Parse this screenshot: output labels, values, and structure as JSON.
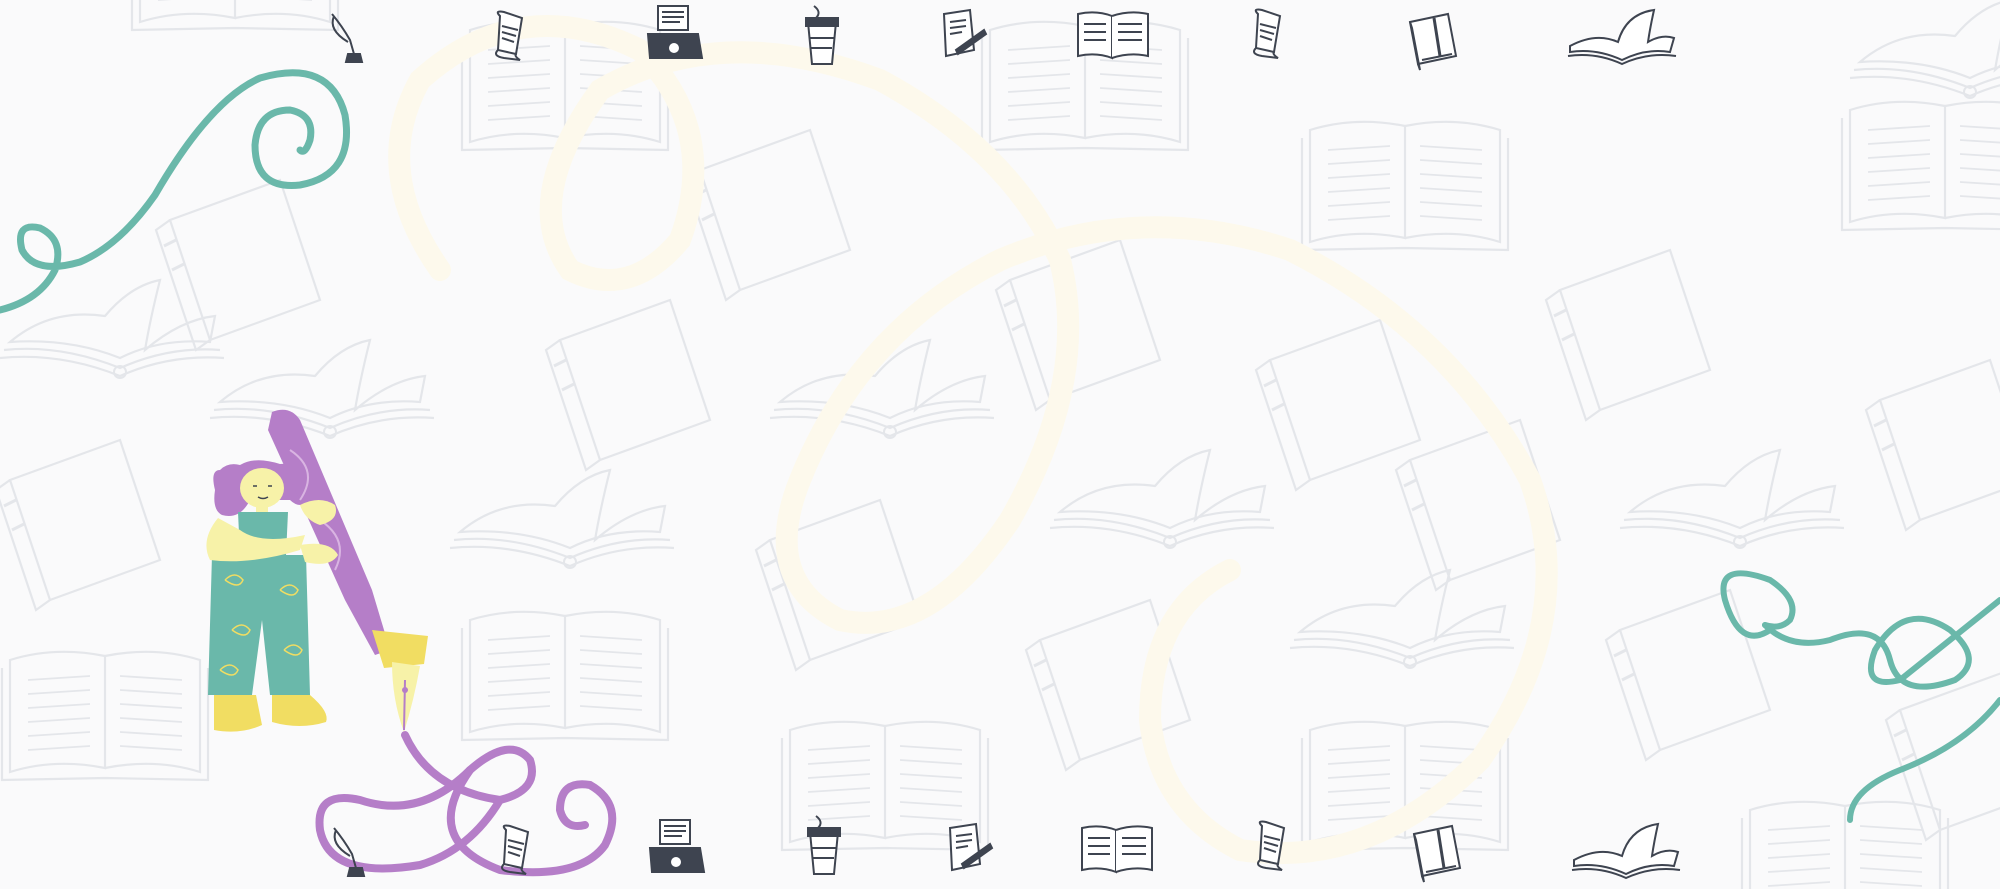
{
  "scene": {
    "background": "#fafafb",
    "pattern_color": "#e4e6ea",
    "swirl_color": "#fdf9ec",
    "teal": "#6ab8aa",
    "purple": "#b57ec8",
    "yellow": "#f1dd62",
    "pale_yellow": "#f7f2a8",
    "ink": "#3e4450",
    "top_icons": [
      "quill-icon",
      "scroll-icon",
      "typewriter-icon",
      "coffee-cup-icon",
      "paper-pen-icon",
      "open-book-icon",
      "scroll-icon",
      "closed-book-icon",
      "open-book-icon"
    ],
    "bottom_icons": [
      "quill-icon",
      "scroll-icon",
      "typewriter-icon",
      "coffee-cup-icon",
      "paper-pen-icon",
      "open-book-icon",
      "scroll-icon",
      "closed-book-icon",
      "open-book-icon"
    ],
    "illustration": "woman-holding-fountain-pen"
  }
}
